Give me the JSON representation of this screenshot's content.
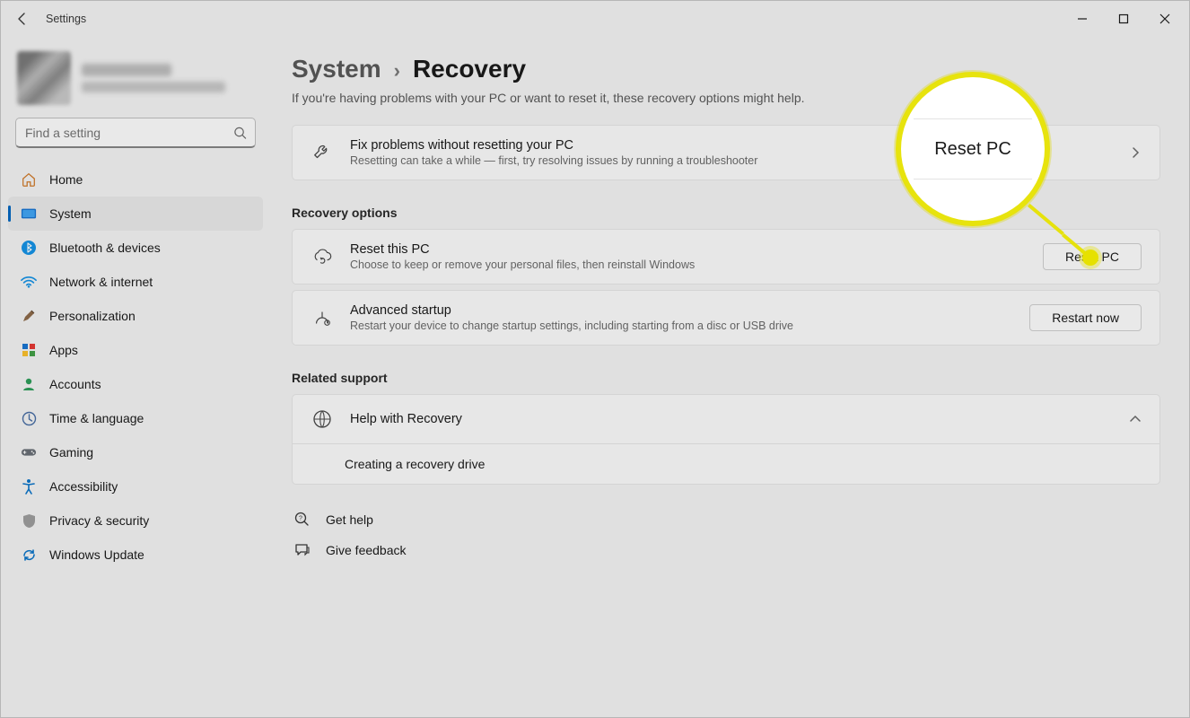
{
  "window": {
    "title": "Settings"
  },
  "search": {
    "placeholder": "Find a setting"
  },
  "sidebar": {
    "items": [
      {
        "label": "Home"
      },
      {
        "label": "System"
      },
      {
        "label": "Bluetooth & devices"
      },
      {
        "label": "Network & internet"
      },
      {
        "label": "Personalization"
      },
      {
        "label": "Apps"
      },
      {
        "label": "Accounts"
      },
      {
        "label": "Time & language"
      },
      {
        "label": "Gaming"
      },
      {
        "label": "Accessibility"
      },
      {
        "label": "Privacy & security"
      },
      {
        "label": "Windows Update"
      }
    ]
  },
  "breadcrumb": {
    "system": "System",
    "page": "Recovery"
  },
  "subtitle": "If you're having problems with your PC or want to reset it, these recovery options might help.",
  "fix": {
    "title": "Fix problems without resetting your PC",
    "desc": "Resetting can take a while — first, try resolving issues by running a troubleshooter"
  },
  "sections": {
    "recovery_options": "Recovery options",
    "related_support": "Related support"
  },
  "reset": {
    "title": "Reset this PC",
    "desc": "Choose to keep or remove your personal files, then reinstall Windows",
    "button": "Reset PC"
  },
  "advanced": {
    "title": "Advanced startup",
    "desc": "Restart your device to change startup settings, including starting from a disc or USB drive",
    "button": "Restart now"
  },
  "support": {
    "help": "Help with Recovery",
    "item1": "Creating a recovery drive"
  },
  "footer": {
    "get_help": "Get help",
    "give_feedback": "Give feedback"
  },
  "annotation": {
    "label": "Reset PC"
  }
}
